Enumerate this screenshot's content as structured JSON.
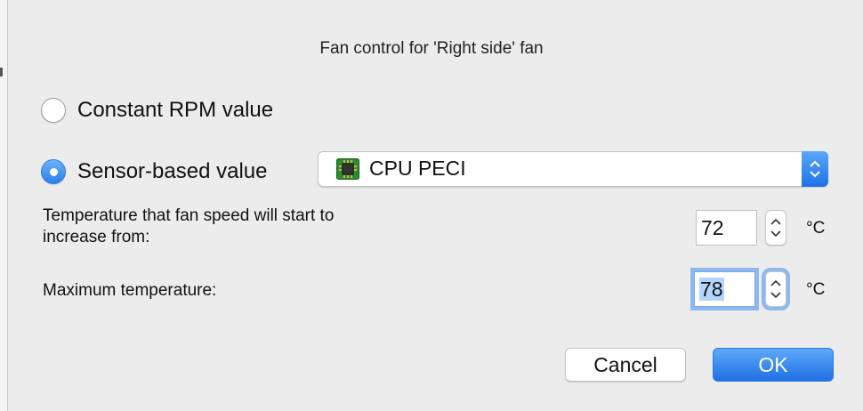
{
  "dialog": {
    "title": "Fan control for 'Right side' fan"
  },
  "mode": {
    "constant_label": "Constant RPM value",
    "sensor_label": "Sensor-based value",
    "selected": "sensor"
  },
  "sensor_popup": {
    "selected_value": "CPU PECI",
    "icon": "cpu-chip-icon"
  },
  "start_temp": {
    "label_line1": "Temperature that fan speed will start to",
    "label_line2": "increase from:",
    "value": "72",
    "unit": "°C"
  },
  "max_temp": {
    "label": "Maximum temperature:",
    "value": "78",
    "unit": "°C",
    "focused": true
  },
  "buttons": {
    "cancel": "Cancel",
    "ok": "OK"
  },
  "colors": {
    "accent": "#1e70e4",
    "window_bg": "#ececec",
    "focus_ring": "#8cb9ef"
  }
}
